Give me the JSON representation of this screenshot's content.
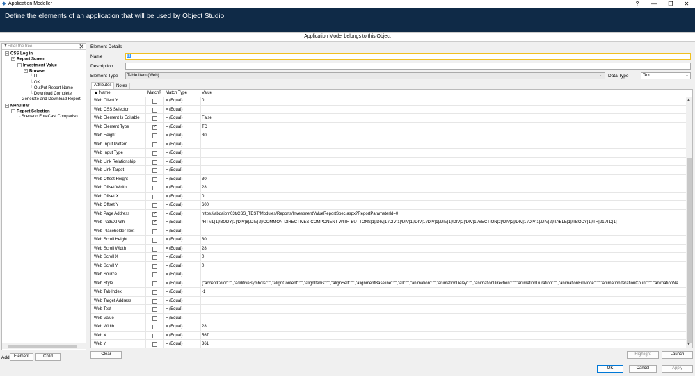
{
  "window": {
    "title": "Application Modeller",
    "help": "?",
    "minimize": "—",
    "restore": "❐",
    "close": "✕"
  },
  "header": {
    "title": "Define the elements of an application that will be used by Object Studio"
  },
  "subbar": {
    "text": "Application Model belongs to this Object"
  },
  "tree": {
    "filter_placeholder": "Filter the tree...",
    "nodes": [
      {
        "label": "CSS Log in",
        "bold": true,
        "depth": 0,
        "exp": true
      },
      {
        "label": "Report Screen",
        "bold": true,
        "depth": 1,
        "exp": true
      },
      {
        "label": "Investment Value",
        "bold": true,
        "depth": 2,
        "exp": true
      },
      {
        "label": "Browser",
        "bold": true,
        "depth": 3,
        "exp": true
      },
      {
        "label": "IT",
        "depth": 4
      },
      {
        "label": "OK",
        "depth": 4
      },
      {
        "label": "OutPut Report Name",
        "depth": 4
      },
      {
        "label": "Download Complete",
        "depth": 4
      },
      {
        "label": "Generate and Download Report",
        "depth": 2
      },
      {
        "label": "Menu Bar",
        "bold": true,
        "depth": 0,
        "exp": true
      },
      {
        "label": "Report Selection",
        "bold": true,
        "depth": 1,
        "exp": true
      },
      {
        "label": "Scenario ForeCast Compariso",
        "depth": 2
      }
    ]
  },
  "add": {
    "label": "Add",
    "element": "Element",
    "child": "Child"
  },
  "details": {
    "section": "Element Details",
    "name_label": "Name",
    "name_value": "IT",
    "description_label": "Description",
    "description_value": "",
    "type_label": "Element Type",
    "type_value": "Table Item (Web)",
    "datatype_label": "Data Type",
    "datatype_value": "Text"
  },
  "tabs": {
    "attributes": "Attributes",
    "notes": "Notes"
  },
  "grid": {
    "headers": {
      "name": "▲ Name",
      "match": "Match?",
      "match_type": "Match Type",
      "value": "Value"
    },
    "rows": [
      {
        "name": "Web Client Y",
        "checked": false,
        "match_type": "= (Equal)",
        "value": "0"
      },
      {
        "name": "Web CSS Selector",
        "checked": false,
        "match_type": "= (Equal)",
        "value": ""
      },
      {
        "name": "Web Element Is Editable",
        "checked": false,
        "match_type": "= (Equal)",
        "value": "False"
      },
      {
        "name": "Web Element Type",
        "checked": true,
        "match_type": "= (Equal)",
        "value": "TD"
      },
      {
        "name": "Web Height",
        "checked": false,
        "match_type": "= (Equal)",
        "value": "30"
      },
      {
        "name": "Web Input Pattern",
        "checked": false,
        "match_type": "= (Equal)",
        "value": ""
      },
      {
        "name": "Web Input Type",
        "checked": false,
        "match_type": "= (Equal)",
        "value": ""
      },
      {
        "name": "Web Link Relationship",
        "checked": false,
        "match_type": "= (Equal)",
        "value": ""
      },
      {
        "name": "Web Link Target",
        "checked": false,
        "match_type": "= (Equal)",
        "value": ""
      },
      {
        "name": "Web Offset Height",
        "checked": false,
        "match_type": "= (Equal)",
        "value": "30"
      },
      {
        "name": "Web Offset Width",
        "checked": false,
        "match_type": "= (Equal)",
        "value": "28"
      },
      {
        "name": "Web Offset X",
        "checked": false,
        "match_type": "= (Equal)",
        "value": "0"
      },
      {
        "name": "Web Offset Y",
        "checked": false,
        "match_type": "= (Equal)",
        "value": "600"
      },
      {
        "name": "Web Page Address",
        "checked": true,
        "match_type": "= (Equal)",
        "value": "https://abqaipm03t/CSS_TEST/Modules/Reports/InvestmentValueReportSpec.aspx?ReportParameterId=0"
      },
      {
        "name": "Web Path/XPath",
        "checked": true,
        "match_type": "= (Equal)",
        "value": "/HTML[1]/BODY[1]/DIV[8]/DIV[2]/COMMON-DIRECTIVES-COMPONENT-WITH-BUTTONS[1]/DIV[1]/DIV[1]/DIV[1]/DIV[1]/DIV[1]/DIV[1]/DIV[2]/DIV[1]/SECTION[2]/DIV[2]/DIV[1]/DIV[1]/DIV[2]/TABLE[1]/TBODY[1]/TR[21]/TD[1]"
      },
      {
        "name": "Web Placeholder Text",
        "checked": false,
        "match_type": "= (Equal)",
        "value": ""
      },
      {
        "name": "Web Scroll Height",
        "checked": false,
        "match_type": "= (Equal)",
        "value": "30"
      },
      {
        "name": "Web Scroll Width",
        "checked": false,
        "match_type": "= (Equal)",
        "value": "28"
      },
      {
        "name": "Web Scroll X",
        "checked": false,
        "match_type": "= (Equal)",
        "value": "0"
      },
      {
        "name": "Web Scroll Y",
        "checked": false,
        "match_type": "= (Equal)",
        "value": "0"
      },
      {
        "name": "Web Source",
        "checked": false,
        "match_type": "= (Equal)",
        "value": ""
      },
      {
        "name": "Web Style",
        "checked": false,
        "match_type": "= (Equal)",
        "value": "{\"accentColor\":\"\",\"additiveSymbols\":\"\",\"alignContent\":\"\",\"alignItems\":\"\",\"alignSelf\":\"\",\"alignmentBaseline\":\"\",\"all\":\"\",\"animation\":\"\",\"animationDelay\":\"\",\"animationDirection\":\"\",\"animationDuration\":\"\",\"animationFillMode\":\"\",\"animationIterationCount\":\"\",\"animationName\"..."
      },
      {
        "name": "Web Tab Index",
        "checked": false,
        "match_type": "= (Equal)",
        "value": "-1"
      },
      {
        "name": "Web Target Address",
        "checked": false,
        "match_type": "= (Equal)",
        "value": ""
      },
      {
        "name": "Web Text",
        "checked": false,
        "match_type": "= (Equal)",
        "value": ""
      },
      {
        "name": "Web Value",
        "checked": false,
        "match_type": "= (Equal)",
        "value": ""
      },
      {
        "name": "Web Width",
        "checked": false,
        "match_type": "= (Equal)",
        "value": "28"
      },
      {
        "name": "Web X",
        "checked": false,
        "match_type": "= (Equal)",
        "value": "567"
      },
      {
        "name": "Web Y",
        "checked": false,
        "match_type": "= (Equal)",
        "value": "361"
      }
    ]
  },
  "buttons": {
    "clear": "Clear",
    "highlight": "Highlight",
    "launch": "Launch",
    "ok": "OK",
    "cancel": "Cancel",
    "apply": "Apply"
  }
}
